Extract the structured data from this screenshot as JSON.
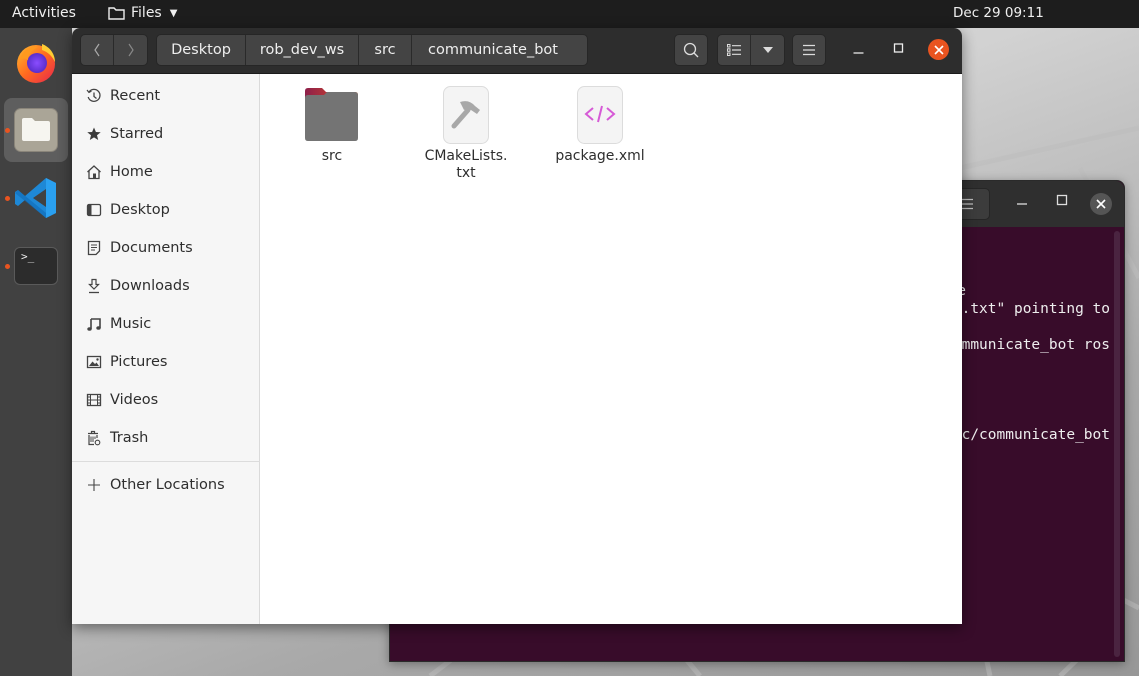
{
  "topbar": {
    "activities": "Activities",
    "app_menu": "Files",
    "clock": "Dec 29  09:11"
  },
  "dock": {
    "items": [
      {
        "name": "Firefox",
        "icon": "firefox-icon",
        "running": false
      },
      {
        "name": "Files",
        "icon": "files-icon",
        "running": true,
        "active": true
      },
      {
        "name": "Visual Studio Code",
        "icon": "vscode-icon",
        "running": true
      },
      {
        "name": "Terminal",
        "icon": "terminal-icon",
        "running": true
      }
    ]
  },
  "files_window": {
    "breadcrumb": [
      "Desktop",
      "rob_dev_ws",
      "src",
      "communicate_bot"
    ],
    "sidebar": {
      "items": [
        {
          "label": "Recent",
          "icon": "clock-icon"
        },
        {
          "label": "Starred",
          "icon": "star-icon"
        },
        {
          "label": "Home",
          "icon": "home-icon"
        },
        {
          "label": "Desktop",
          "icon": "desktop-icon"
        },
        {
          "label": "Documents",
          "icon": "document-icon"
        },
        {
          "label": "Downloads",
          "icon": "download-icon"
        },
        {
          "label": "Music",
          "icon": "music-icon"
        },
        {
          "label": "Pictures",
          "icon": "picture-icon"
        },
        {
          "label": "Videos",
          "icon": "video-icon"
        },
        {
          "label": "Trash",
          "icon": "trash-icon"
        }
      ],
      "other_locations": "Other Locations"
    },
    "files": [
      {
        "name": "src",
        "type": "folder"
      },
      {
        "name": "CMakeLists.\ntxt",
        "type": "cmake"
      },
      {
        "name": "package.xml",
        "type": "xml"
      }
    ]
  },
  "terminal": {
    "lines": [
      "e",
      ".txt\" pointing to",
      "mmunicate_bot ros",
      "c/communicate_bot"
    ]
  },
  "colors": {
    "accent": "#e95420",
    "terminal_bg": "#380c2a",
    "topbar_bg": "#1d1d1d",
    "dock_bg": "#414141"
  }
}
